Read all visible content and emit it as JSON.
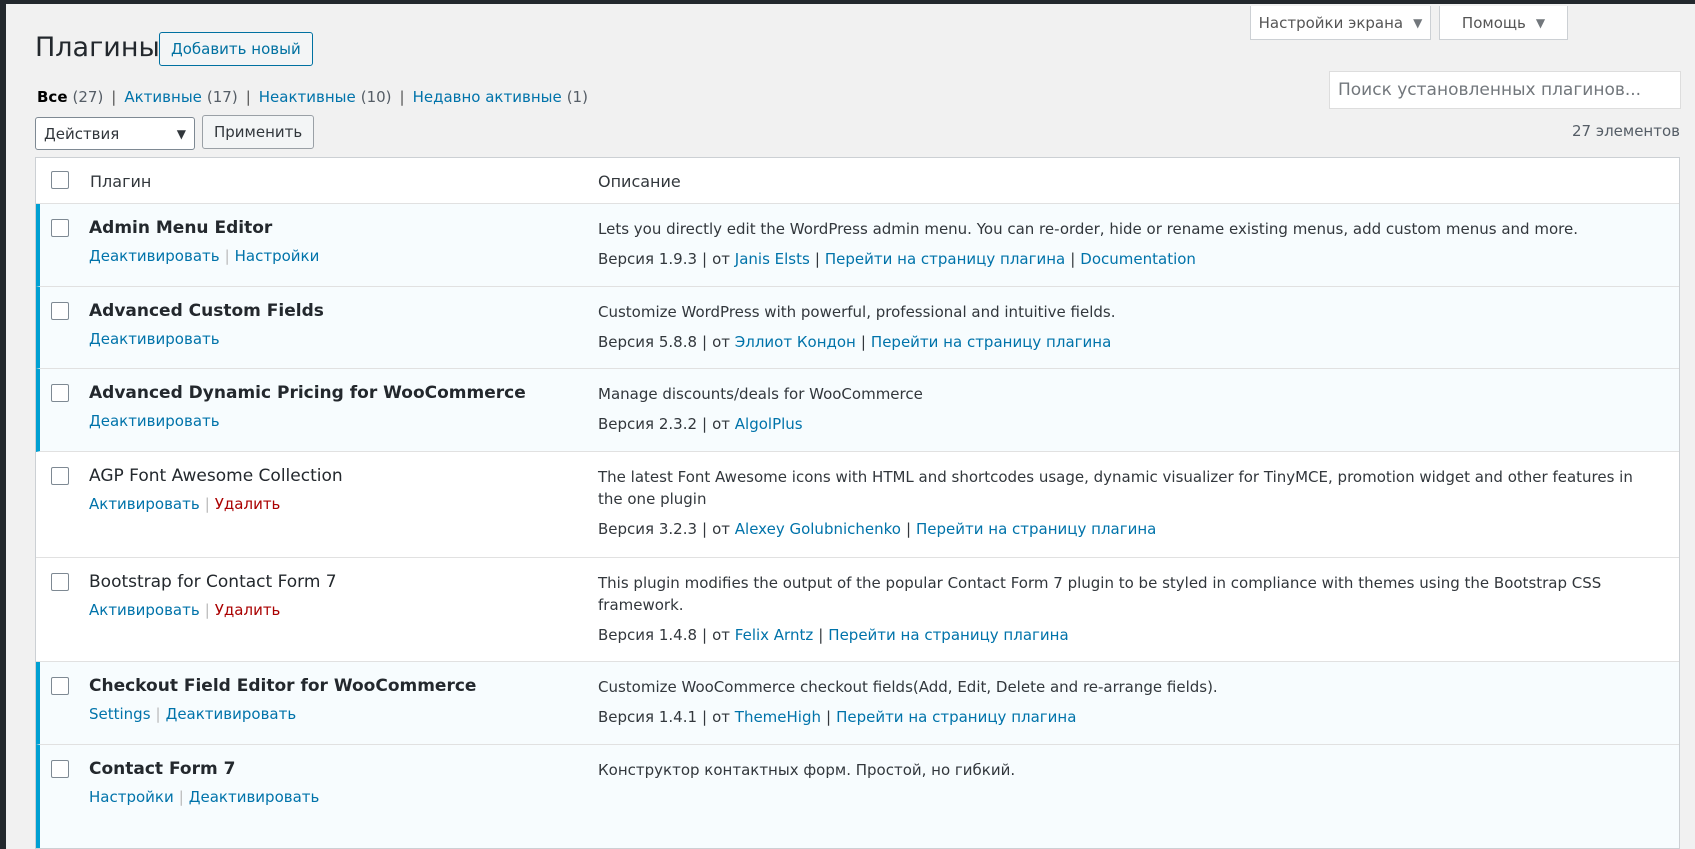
{
  "header": {
    "screen_options": "Настройки экрана",
    "help": "Помощь",
    "title": "Плагины",
    "add_new": "Добавить новый"
  },
  "filters": {
    "all": {
      "label": "Все",
      "count": "(27)"
    },
    "active": {
      "label": "Активные",
      "count": "(17)"
    },
    "inactive": {
      "label": "Неактивные",
      "count": "(10)"
    },
    "recent": {
      "label": "Недавно активные",
      "count": "(1)"
    }
  },
  "search": {
    "placeholder": "Поиск установленных плагинов..."
  },
  "bulk": {
    "selected": "Действия",
    "apply": "Применить"
  },
  "items_count": "27 элементов",
  "table": {
    "col_plugin": "Плагин",
    "col_description": "Описание",
    "version_prefix": "Версия",
    "by": "от",
    "rows": [
      {
        "name": "Admin Menu Editor",
        "actions": [
          "Деактивировать",
          "Настройки"
        ],
        "description": "Lets you directly edit the WordPress admin menu. You can re-order, hide or rename existing menus, add custom menus and more.",
        "version": "1.9.3",
        "author": "Janis Elsts",
        "links": [
          "Перейти на страницу плагина",
          "Documentation"
        ]
      },
      {
        "name": "Advanced Custom Fields",
        "actions": [
          "Деактивировать"
        ],
        "description": "Customize WordPress with powerful, professional and intuitive fields.",
        "version": "5.8.8",
        "author": "Эллиот Кондон",
        "links": [
          "Перейти на страницу плагина"
        ]
      },
      {
        "name": "Advanced Dynamic Pricing for WooCommerce",
        "actions": [
          "Деактивировать"
        ],
        "description": "Manage discounts/deals for WooCommerce",
        "version": "2.3.2",
        "author": "AlgolPlus",
        "links": []
      },
      {
        "name": "AGP Font Awesome Collection",
        "actions": [
          "Активировать",
          "Удалить"
        ],
        "description": "The latest Font Awesome icons with HTML and shortcodes usage, dynamic visualizer for TinyMCE, promotion widget and other features in the one plugin",
        "version": "3.2.3",
        "author": "Alexey Golubnichenko",
        "links": [
          "Перейти на страницу плагина"
        ]
      },
      {
        "name": "Bootstrap for Contact Form 7",
        "actions": [
          "Активировать",
          "Удалить"
        ],
        "description": "This plugin modifies the output of the popular Contact Form 7 plugin to be styled in compliance with themes using the Bootstrap CSS framework.",
        "version": "1.4.8",
        "author": "Felix Arntz",
        "links": [
          "Перейти на страницу плагина"
        ]
      },
      {
        "name": "Checkout Field Editor for WooCommerce",
        "actions": [
          "Settings",
          "Деактивировать"
        ],
        "description": "Customize WooCommerce checkout fields(Add, Edit, Delete and re-arrange fields).",
        "version": "1.4.1",
        "author": "ThemeHigh",
        "links": [
          "Перейти на страницу плагина"
        ]
      },
      {
        "name": "Contact Form 7",
        "actions": [
          "Настройки",
          "Деактивировать"
        ],
        "description": "Конструктор контактных форм. Простой, но гибкий.",
        "version": "",
        "author": "",
        "links": []
      }
    ]
  },
  "colors": {
    "accent": "#00a0d2",
    "link": "#0073aa",
    "delete": "#aa0000",
    "active_row_bg": "#f7fcfe"
  },
  "icons": {
    "dropdown": "triangle-down-icon",
    "select": "chevron-down-icon"
  }
}
